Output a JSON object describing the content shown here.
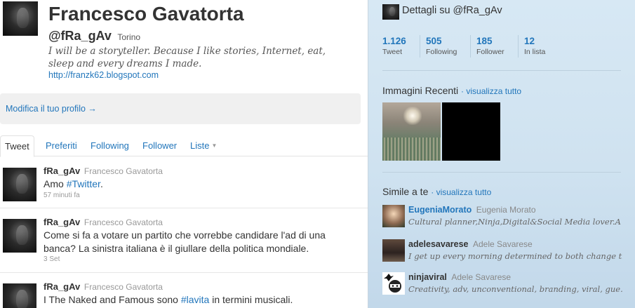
{
  "profile": {
    "name": "Francesco Gavatorta",
    "handle": "@fRa_gAv",
    "location": "Torino",
    "bio": "I will be a storyteller. Because I like stories, Internet, eat, sleep and every dreams I made.",
    "url": "http://franzk62.blogspot.com",
    "edit_link": "Modifica il tuo profilo →"
  },
  "tabs": [
    {
      "label": "Tweet"
    },
    {
      "label": "Preferiti"
    },
    {
      "label": "Following"
    },
    {
      "label": "Follower"
    },
    {
      "label": "Liste"
    }
  ],
  "tweets": [
    {
      "handle": "fRa_gAv",
      "fullname": "Francesco Gavatorta",
      "text_before": "Amo ",
      "hashtag": "#Twitter",
      "text_after": ".",
      "time": "57 minuti fa"
    },
    {
      "handle": "fRa_gAv",
      "fullname": "Francesco Gavatorta",
      "text": "Come si fa a votare un partito che vorrebbe candidare l'ad di una banca? La sinistra italiana è il giullare della politica mondiale.",
      "time": "3 Set"
    },
    {
      "handle": "fRa_gAv",
      "fullname": "Francesco Gavatorta",
      "text_before": "I The Naked and Famous sono ",
      "hashtag": "#lavita",
      "text_after": " in termini musicali."
    }
  ],
  "details": {
    "title": "Dettagli su @fRa_gAv",
    "stats": [
      {
        "value": "1.126",
        "label": "Tweet"
      },
      {
        "value": "505",
        "label": "Following"
      },
      {
        "value": "185",
        "label": "Follower"
      },
      {
        "value": "12",
        "label": "In lista"
      }
    ]
  },
  "recent_images": {
    "title": "Immagini Recenti",
    "link": "· visualizza tutto"
  },
  "similar": {
    "title": "Simile a te",
    "link": "· visualizza tutto",
    "users": [
      {
        "handle": "EugeniaMorato",
        "name": "Eugenia Morato",
        "bio": "Cultural planner,Ninja,Digital&Social Media lover.A ?..."
      },
      {
        "handle": "adelesavarese",
        "name": "Adele Savarese",
        "bio": "I get up every morning determined to both change th..."
      },
      {
        "handle": "ninjaviral",
        "name": "Adele Savarese",
        "bio": "Creativity, adv, unconventional, branding, viral, gue..."
      }
    ]
  },
  "colors": {
    "link": "#2276bb",
    "sidebar_bg": "#d7e8f4",
    "text": "#333333"
  }
}
